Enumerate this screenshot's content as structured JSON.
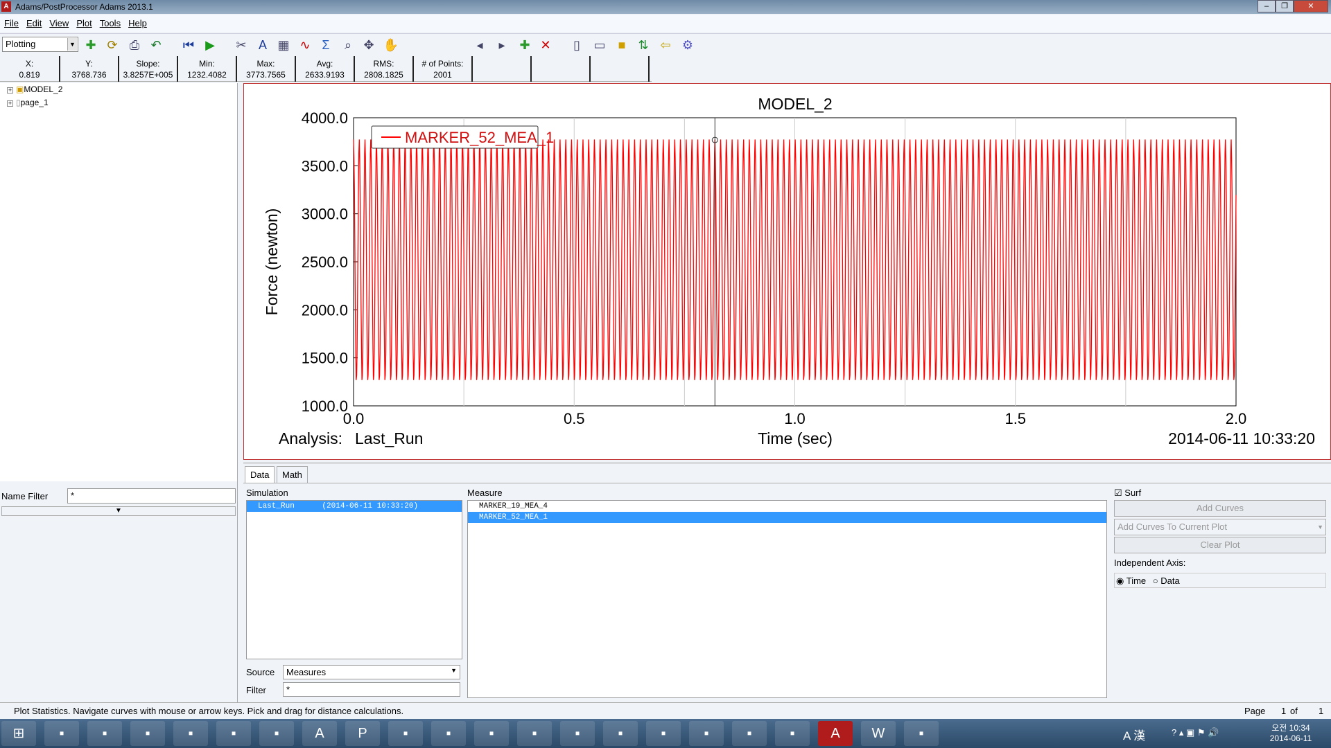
{
  "window": {
    "title": "Adams/PostProcessor Adams 2013.1",
    "logo": "A"
  },
  "menu": [
    "File",
    "Edit",
    "View",
    "Plot",
    "Tools",
    "Help"
  ],
  "toolbar": {
    "mode": "Plotting",
    "icons": [
      "new-page-icon",
      "refresh-icon",
      "print-icon",
      "undo-icon",
      "rewind-icon",
      "play-icon",
      "tools-icon",
      "text-icon",
      "table-icon",
      "curve-edit-icon",
      "sum-icon",
      "zoom-box-icon",
      "fit-icon",
      "pan-hand-icon",
      "prev-page-icon",
      "next-page-icon",
      "new-page-icon",
      "delete-page-icon",
      "layout-1-icon",
      "layout-2-icon",
      "layout-3-icon",
      "swap-icon",
      "exit-icon",
      "settings-icon"
    ]
  },
  "stats": [
    {
      "label": "X:",
      "value": "0.819"
    },
    {
      "label": "Y:",
      "value": "3768.736"
    },
    {
      "label": "Slope:",
      "value": "3.8257E+005"
    },
    {
      "label": "Min:",
      "value": "1232.4082"
    },
    {
      "label": "Max:",
      "value": "3773.7565"
    },
    {
      "label": "Avg:",
      "value": "2633.9193"
    },
    {
      "label": "RMS:",
      "value": "2808.1825"
    },
    {
      "label": "# of Points:",
      "value": "2001"
    }
  ],
  "tree": [
    {
      "label": "MODEL_2"
    },
    {
      "label": "page_1"
    }
  ],
  "name_filter": {
    "label": "Name Filter",
    "value": "*"
  },
  "chart_data": {
    "type": "line",
    "title": "MODEL_2",
    "xlabel": "Time (sec)",
    "ylabel": "Force (newton)",
    "xlim": [
      0,
      2
    ],
    "ylim": [
      1000,
      4000
    ],
    "xticks": [
      "0.0",
      "0.5",
      "1.0",
      "1.5",
      "2.0"
    ],
    "yticks": [
      "1000.0",
      "1500.0",
      "2000.0",
      "2500.0",
      "3000.0",
      "3500.0",
      "4000.0"
    ],
    "series": [
      {
        "name": "MARKER_52_MEA_1",
        "color": "#ff0000",
        "min": 1232.4082,
        "max": 3773.7565,
        "points": 2001
      }
    ],
    "legend": "top-left",
    "cursor_x": 0.819,
    "cursor_y": 3768.736,
    "analysis_label": "Analysis:",
    "analysis": "Last_Run",
    "timestamp": "2014-06-11 10:33:20"
  },
  "panel": {
    "tabs": [
      "Data",
      "Math"
    ],
    "simulation_label": "Simulation",
    "measure_label": "Measure",
    "simulations": [
      {
        "name": "Last_Run",
        "date": "(2014-06-11 10:33:20)"
      }
    ],
    "measures": [
      "MARKER_19_MEA_4",
      "MARKER_52_MEA_1"
    ],
    "surf": "Surf",
    "add_curves": "Add Curves",
    "add_mode": "Add Curves To Current Plot",
    "clear_plot": "Clear Plot",
    "indep_label": "Independent Axis:",
    "time": "Time",
    "data": "Data",
    "source_label": "Source",
    "source": "Measures",
    "filter_label": "Filter",
    "filter": "*"
  },
  "status": {
    "text": "Plot Statistics.  Navigate curves with mouse or arrow keys.  Pick and drag for distance calculations.",
    "page_label": "Page",
    "page": "1",
    "of": "of",
    "total": "1"
  },
  "taskbar": {
    "apps": [
      "windows-start-icon",
      "ie-icon",
      "explorer-icon",
      "media-icon",
      "app-icon",
      "app-icon",
      "ansys-icon",
      "a-icon",
      "p-icon",
      "app-icon",
      "norton-icon",
      "excel-icon",
      "app-icon",
      "app-icon",
      "app-icon",
      "app-icon",
      "talk-icon",
      "app-icon",
      "app-icon",
      "adams-icon",
      "word-icon",
      "app-icon"
    ],
    "ime": "A 漢",
    "time": "오전 10:34",
    "date": "2014-06-11"
  }
}
